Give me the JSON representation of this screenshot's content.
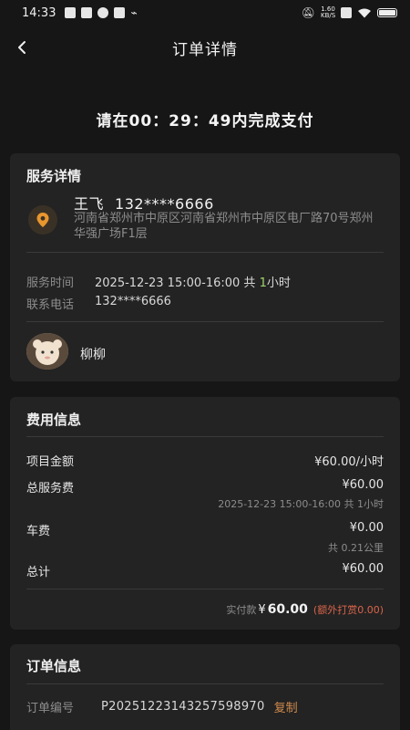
{
  "status_bar": {
    "time": "14:33",
    "network_speed_value": "1.60",
    "network_speed_unit": "KB/S"
  },
  "nav": {
    "title": "订单详情"
  },
  "countdown": {
    "text": "请在00：29：49内完成支付"
  },
  "service": {
    "title": "服务详情",
    "contact_name": "王飞",
    "contact_phone": "132****6666",
    "address": "河南省郑州市中原区河南省郑州市中原区电厂路70号郑州华强广场F1层",
    "time_label": "服务时间",
    "time_value_prefix": "2025-12-23 15:00-16:00 共",
    "time_value_hours": "1",
    "time_value_suffix": "小时",
    "phone_label": "联系电话",
    "phone_value": "132****6666",
    "staff_name": "柳柳"
  },
  "fee": {
    "title": "费用信息",
    "item_label": "项目金额",
    "item_value": "¥60.00/小时",
    "service_label": "总服务费",
    "service_value": "¥60.00",
    "service_sub": "2025-12-23 15:00-16:00 共 1小时",
    "car_label": "车费",
    "car_value": "¥0.00",
    "car_sub": "共 0.21公里",
    "total_label": "总计",
    "total_value": "¥60.00",
    "paid_label": "实付款",
    "paid_currency": "¥",
    "paid_value": "60.00",
    "paid_tip": "(额外打赏0.00)"
  },
  "order": {
    "title": "订单信息",
    "number_label": "订单编号",
    "number_value": "P20251223143257598970",
    "copy_label": "复制"
  },
  "colors": {
    "background": "#161616",
    "card": "#232323",
    "accent_orange": "#d08a4c",
    "accent_green": "#9fd46a",
    "tip_red": "#d9644a"
  }
}
